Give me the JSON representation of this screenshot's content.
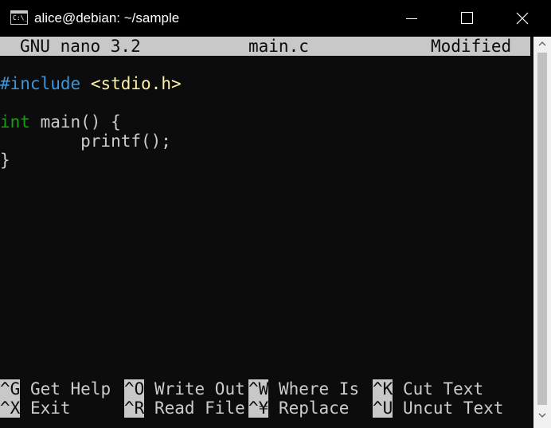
{
  "window": {
    "title": "alice@debian: ~/sample",
    "app_icon_text": "C:\\_",
    "controls": [
      "minimize",
      "maximize",
      "close"
    ]
  },
  "nano": {
    "version": "GNU nano 3.2",
    "filename": "main.c",
    "status": "Modified"
  },
  "code": {
    "line1_directive": "#include",
    "line1_header": "<stdio.h>",
    "line2": "",
    "line3_type": "int",
    "line3_rest": " main() {",
    "line4": "        printf();",
    "line5": "}"
  },
  "shortcuts": [
    {
      "key": "^G",
      "label": "Get Help"
    },
    {
      "key": "^O",
      "label": "Write Out"
    },
    {
      "key": "^W",
      "label": "Where Is"
    },
    {
      "key": "^K",
      "label": "Cut Text"
    },
    {
      "key": "^X",
      "label": "Exit"
    },
    {
      "key": "^R",
      "label": "Read File"
    },
    {
      "key": "^¥",
      "label": "Replace"
    },
    {
      "key": "^U",
      "label": "Uncut Text"
    }
  ],
  "colors": {
    "terminal_bg": "#0c0c0c",
    "bar_bg": "#c8c8c8",
    "preprocessor": "#3a96dd",
    "string": "#f9f1a5",
    "type": "#13a10e",
    "text": "#cccccc"
  }
}
